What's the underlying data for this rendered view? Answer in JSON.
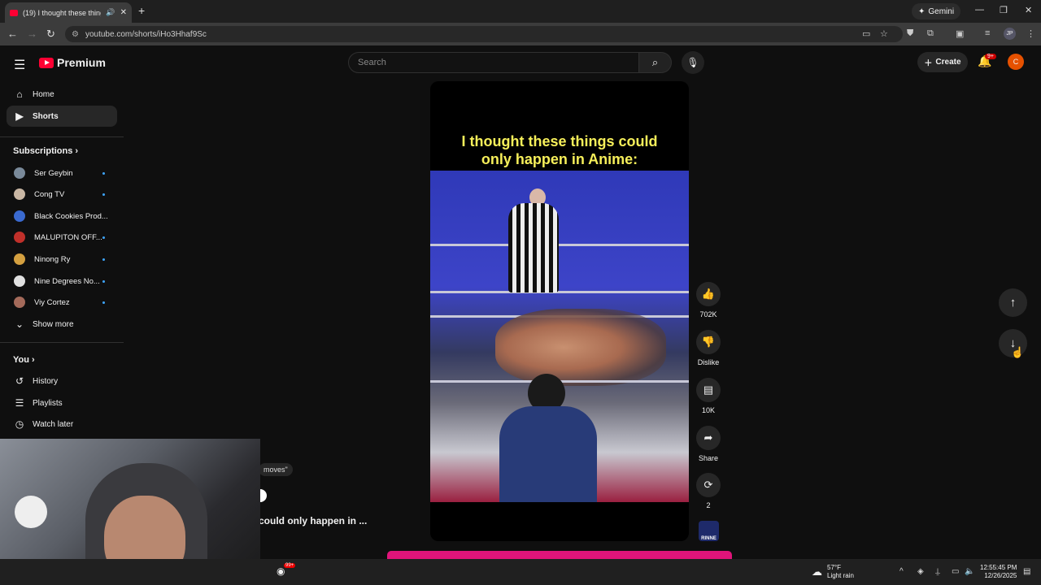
{
  "browser": {
    "tab_title": "(19) I thought these things",
    "url": "youtube.com/shorts/iHo3Hhaf9Sc",
    "gemini_label": "Gemini",
    "profile_initials": "JP"
  },
  "header": {
    "logo_text": "Premium",
    "search_placeholder": "Search",
    "create_label": "Create",
    "notification_count": "9+",
    "avatar_initial": "C"
  },
  "sidebar": {
    "nav": [
      {
        "label": "Home",
        "icon": "home-icon"
      },
      {
        "label": "Shorts",
        "icon": "shorts-icon"
      }
    ],
    "subscriptions_heading": "Subscriptions",
    "subscriptions": [
      {
        "name": "Ser Geybin",
        "color": "#7a8a9a",
        "new": true
      },
      {
        "name": "Cong TV",
        "color": "#c9b7a4",
        "new": true
      },
      {
        "name": "Black Cookies Prod...",
        "color": "#3a6ad0",
        "new": false
      },
      {
        "name": "MALUPITON OFF...",
        "color": "#c0302a",
        "new": true
      },
      {
        "name": "Ninong Ry",
        "color": "#d4a040",
        "new": true
      },
      {
        "name": "Nine Degrees No...",
        "color": "#e0e0e0",
        "new": true
      },
      {
        "name": "Viy Cortez",
        "color": "#a46a5a",
        "new": true
      }
    ],
    "show_more": "Show more",
    "you_heading": "You",
    "you_items": [
      {
        "label": "History",
        "icon": "history-icon"
      },
      {
        "label": "Playlists",
        "icon": "playlists-icon"
      },
      {
        "label": "Watch later",
        "icon": "watch-later-icon"
      }
    ]
  },
  "short": {
    "caption_line1": "I thought these things could",
    "caption_line2": "only happen in Anime:",
    "likes": "702K",
    "dislike_label": "Dislike",
    "comments": "10K",
    "share_label": "Share",
    "remix_count": "2",
    "channel_thumb_text": "RINNE",
    "title_fragment": "could only happen in ...",
    "sound_fragment": "moves\""
  },
  "taskbar": {
    "weather_temp": "57°F",
    "weather_desc": "Light rain",
    "time": "12:55:45 PM",
    "date": "12/26/2025",
    "app_badge": "99+"
  }
}
